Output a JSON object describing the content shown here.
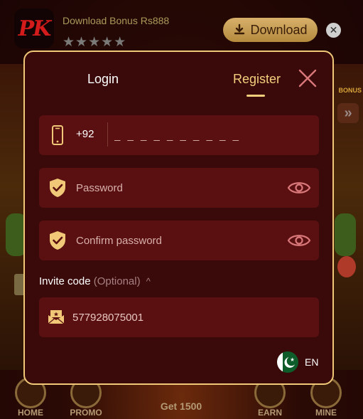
{
  "banner": {
    "app_logo_text": "PK",
    "title": "Download Bonus Rs888",
    "stars": "★★★★★",
    "download_label": "Download",
    "close_glyph": "✕"
  },
  "background_app": {
    "right_bonus_label": "BONUS",
    "nav": {
      "home": "HOME",
      "promo": "PROMO",
      "center": "Get 1500",
      "earn": "EARN",
      "mine": "MINE"
    }
  },
  "modal": {
    "tabs": {
      "login": "Login",
      "register": "Register",
      "active": "register"
    },
    "phone": {
      "country_code": "+92",
      "placeholder": "_ _ _ _ _ _ _ _ _ _"
    },
    "password": {
      "placeholder": "Password"
    },
    "confirm_password": {
      "placeholder": "Confirm password"
    },
    "invite": {
      "label": "Invite code",
      "optional_text": "(Optional)",
      "caret": "^",
      "value": "577928075001"
    },
    "language": {
      "code": "EN",
      "flag_icon": "pakistan-flag-icon"
    }
  },
  "colors": {
    "accent_gold": "#f3cf7d",
    "modal_bg": "#3a0a0a",
    "field_bg": "#5a0f10",
    "border": "#f0c878"
  }
}
